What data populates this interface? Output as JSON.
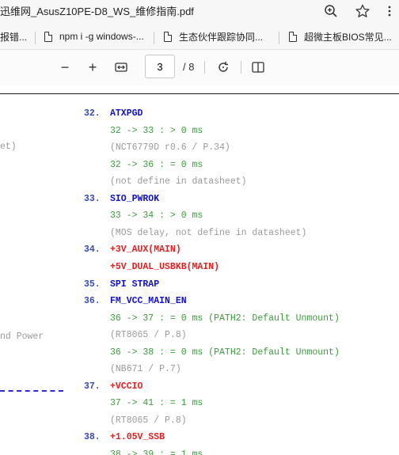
{
  "browser": {
    "tab_title": "迅维网_AsusZ10PE-D8_WS_维修指南.pdf",
    "bookmarks": [
      {
        "label": "报错..."
      },
      {
        "label": "npm i -g windows-..."
      },
      {
        "label": "生态伙伴跟踪协同..."
      },
      {
        "label": "超微主板BIOS常见..."
      }
    ]
  },
  "pdf_toolbar": {
    "current_page": "3",
    "total_pages": "/ 8",
    "zoom_out": "−",
    "zoom_in": "+"
  },
  "document": {
    "left_fragments": [
      {
        "text": "et)"
      },
      {
        "text": "nd Power"
      }
    ],
    "lines": [
      {
        "num": "32.",
        "text": "ATXPGD",
        "style": "blue"
      },
      {
        "text": "32 -> 33 : > 0 ms",
        "style": "green"
      },
      {
        "text": "(NCT6779D r0.6 / P.34)",
        "style": "gray"
      },
      {
        "text": "32 -> 36 : = 0 ms",
        "style": "green"
      },
      {
        "text": "(not define in datasheet)",
        "style": "gray"
      },
      {
        "num": "33.",
        "text": "SIO_PWROK",
        "style": "blue"
      },
      {
        "text": "33 -> 34 : > 0 ms",
        "style": "green"
      },
      {
        "text": "(MOS delay, not define in datasheet)",
        "style": "gray"
      },
      {
        "num": "34.",
        "text": "+3V_AUX(MAIN)",
        "style": "red"
      },
      {
        "text": "+5V_DUAL_USBKB(MAIN)",
        "style": "red"
      },
      {
        "num": "35.",
        "text": "SPI STRAP",
        "style": "blue"
      },
      {
        "num": "36.",
        "text": "FM_VCC_MAIN_EN",
        "style": "blue"
      },
      {
        "text": "36 -> 37 : = 0 ms (PATH2: Default Unmount)",
        "style": "green"
      },
      {
        "text": "(RT8065 / P.8)",
        "style": "gray"
      },
      {
        "text": "36 -> 38 : = 0 ms (PATH2: Default Unmount)",
        "style": "green"
      },
      {
        "text": "(NB671 / P.7)",
        "style": "gray"
      },
      {
        "num": "37.",
        "text": "+VCCIO",
        "style": "red"
      },
      {
        "text": "37 -> 41 : = 1 ms",
        "style": "green"
      },
      {
        "text": "(RT8065 / P.8)",
        "style": "gray"
      },
      {
        "num": "38.",
        "text": "+1.05V_SSB",
        "style": "red"
      },
      {
        "text": "38 -> 39 : = 1 ms",
        "style": "green"
      }
    ]
  }
}
